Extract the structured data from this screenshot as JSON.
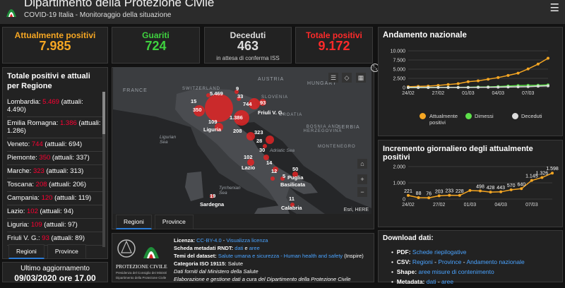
{
  "header": {
    "title": "Dipartimento della Protezione Civile",
    "subtitle": "COVID-19 Italia - Monitoraggio della situazione",
    "menu_icon": "hamburger-menu-icon"
  },
  "stats": {
    "active": {
      "label": "Attualmente positivi",
      "value": "7.985",
      "color": "#f5a623"
    },
    "recovered": {
      "label": "Guariti",
      "value": "724",
      "color": "#3fd13f"
    },
    "deceased": {
      "label": "Deceduti",
      "value": "463",
      "note": "in attesa di conferma ISS",
      "color": "#dddddd"
    },
    "total": {
      "label": "Totale positivi",
      "value": "9.172",
      "color": "#ff2a2a"
    }
  },
  "regions_panel": {
    "title_line1": "Totale positivi e attuali",
    "title_line2": "per Regione",
    "rows": [
      {
        "name": "Lombardia: ",
        "num": "5.469",
        "rest": " (attuali:",
        "rest2": "4.490)"
      },
      {
        "name": "Emilia Romagna: ",
        "num": "1.386",
        "rest": " (attuali:",
        "rest2": "1.286)"
      },
      {
        "name": "Veneto: ",
        "num": "744",
        "rest": " (attuali: 694)"
      },
      {
        "name": "Piemonte: ",
        "num": "350",
        "rest": " (attuali: 337)"
      },
      {
        "name": "Marche: ",
        "num": "323",
        "rest": " (attuali: 313)"
      },
      {
        "name": "Toscana: ",
        "num": "208",
        "rest": " (attuali: 206)"
      },
      {
        "name": "Campania: ",
        "num": "120",
        "rest": " (attuali: 119)"
      },
      {
        "name": "Lazio: ",
        "num": "102",
        "rest": " (attuali: 94)"
      },
      {
        "name": "Liguria: ",
        "num": "109",
        "rest": " (attuali: 97)"
      },
      {
        "name": "Friuli V. G.: ",
        "num": "93",
        "rest": " (attuali: 89)"
      }
    ],
    "tabs": [
      "Regioni",
      "Province"
    ]
  },
  "update": {
    "label": "Ultimo aggiornamento",
    "value": "09/03/2020 ore 17.00"
  },
  "map": {
    "countries": [
      "FRANCE",
      "SWITZERLAND",
      "AUSTRIA",
      "HUNGARY",
      "SLOVENIA",
      "CROATIA",
      "BOSNIA AND HERZEGOVINA",
      "SERBIA",
      "MONTENEGRO"
    ],
    "seas": [
      "Ligurian Sea",
      "Adriatic Sea",
      "Tyrrhenian Sea"
    ],
    "numbers": [
      "5.469",
      "9",
      "33",
      "15",
      "744",
      "93",
      "350",
      "1.386",
      "109",
      "208",
      "323",
      "28",
      "30",
      "102",
      "14",
      "12",
      "50",
      "5",
      "19",
      "11"
    ],
    "places": [
      "Friuli V. G.",
      "Liguria",
      "Lazio",
      "Puglia",
      "Basilicata",
      "Sardegna",
      "Calabria"
    ],
    "attribution": "Esri, HERE",
    "tabs": [
      "Regioni",
      "Province"
    ]
  },
  "info": {
    "licenza_label": "Licenza:",
    "licenza_value": "CC-BY-4.0",
    "licenza_link": "Visualizza licenza",
    "scheda_label": "Scheda metadati RNDT:",
    "scheda_dati": "dati",
    "scheda_e": "e",
    "scheda_aree": "aree",
    "temi_label": "Temi del dataset:",
    "temi_value": "Salute umana e sicurezza - Human health and safety",
    "temi_suffix": "(Inspire)",
    "iso_label": "Categoria ISO 19115:",
    "iso_value": "Salute",
    "dati_forniti": "Dati forniti dal Ministero della Salute",
    "elaborazione": "Elaborazione e gestione dati a cura del Dipartimento della Protezione Civile",
    "logo_text": "PROTEZIONE CIVILE",
    "logo_sub1": "Presidenza del Consiglio dei Ministri",
    "logo_sub2": "Dipartimento della Protezione Civile"
  },
  "downloads": {
    "title": "Download dati:",
    "pdf_label": "PDF:",
    "pdf_link": "Schede riepilogative",
    "csv_label": "CSV:",
    "csv_regioni": "Regioni",
    "csv_province": "Province",
    "csv_andamento": "Andamento nazionale",
    "shape_label": "Shape:",
    "shape_link": "aree misure di contenimento",
    "meta_label": "Metadata:",
    "meta_dati": "dati",
    "meta_aree": "aree"
  },
  "chart_titles": {
    "national": "Andamento nazionale",
    "daily": "Incremento giornaliero degli attualmente positivi"
  },
  "chart_data": [
    {
      "type": "line",
      "title": "Andamento nazionale",
      "x": [
        "24/02",
        "25/02",
        "26/02",
        "27/02",
        "28/02",
        "29/02",
        "01/03",
        "02/03",
        "03/03",
        "04/03",
        "05/03",
        "06/03",
        "07/03",
        "08/03",
        "09/03"
      ],
      "x_ticks": [
        "24/02",
        "27/02",
        "01/03",
        "04/03",
        "07/03"
      ],
      "y_ticks": [
        "0",
        "2.500",
        "5.000",
        "7.500",
        "10.000"
      ],
      "ylim": [
        0,
        10000
      ],
      "series": [
        {
          "name": "Attualmente positivi",
          "color": "#f5a623",
          "values": [
            221,
            311,
            385,
            588,
            821,
            1049,
            1577,
            1835,
            2263,
            2706,
            3296,
            3916,
            5061,
            6387,
            7985
          ]
        },
        {
          "name": "Dimessi",
          "color": "#5de04a",
          "values": [
            1,
            1,
            3,
            45,
            46,
            50,
            83,
            149,
            160,
            276,
            414,
            523,
            589,
            622,
            724
          ]
        },
        {
          "name": "Deceduti",
          "color": "#dddddd",
          "values": [
            7,
            10,
            12,
            17,
            21,
            29,
            34,
            52,
            79,
            107,
            148,
            197,
            233,
            366,
            463
          ]
        }
      ]
    },
    {
      "type": "line",
      "title": "Incremento giornaliero degli attualmente positivi",
      "x": [
        "24/02",
        "25/02",
        "26/02",
        "27/02",
        "28/02",
        "29/02",
        "01/03",
        "02/03",
        "03/03",
        "04/03",
        "05/03",
        "06/03",
        "07/03",
        "08/03",
        "09/03"
      ],
      "x_ticks": [
        "24/02",
        "27/02",
        "01/03",
        "04/03",
        "07/03"
      ],
      "y_ticks": [
        "0",
        "1.000",
        "2.000"
      ],
      "ylim": [
        0,
        2000
      ],
      "series": [
        {
          "color": "#f5a623",
          "values": [
            221,
            88,
            76,
            203,
            233,
            228,
            528,
            498,
            428,
            443,
            570,
            640,
            1145,
            1326,
            1598
          ],
          "labels": [
            "221",
            "88",
            "76",
            "203",
            "233",
            "228",
            "",
            "498",
            "428",
            "443",
            "570",
            "640",
            "1.145",
            "1.326",
            "1.598"
          ]
        }
      ]
    }
  ]
}
